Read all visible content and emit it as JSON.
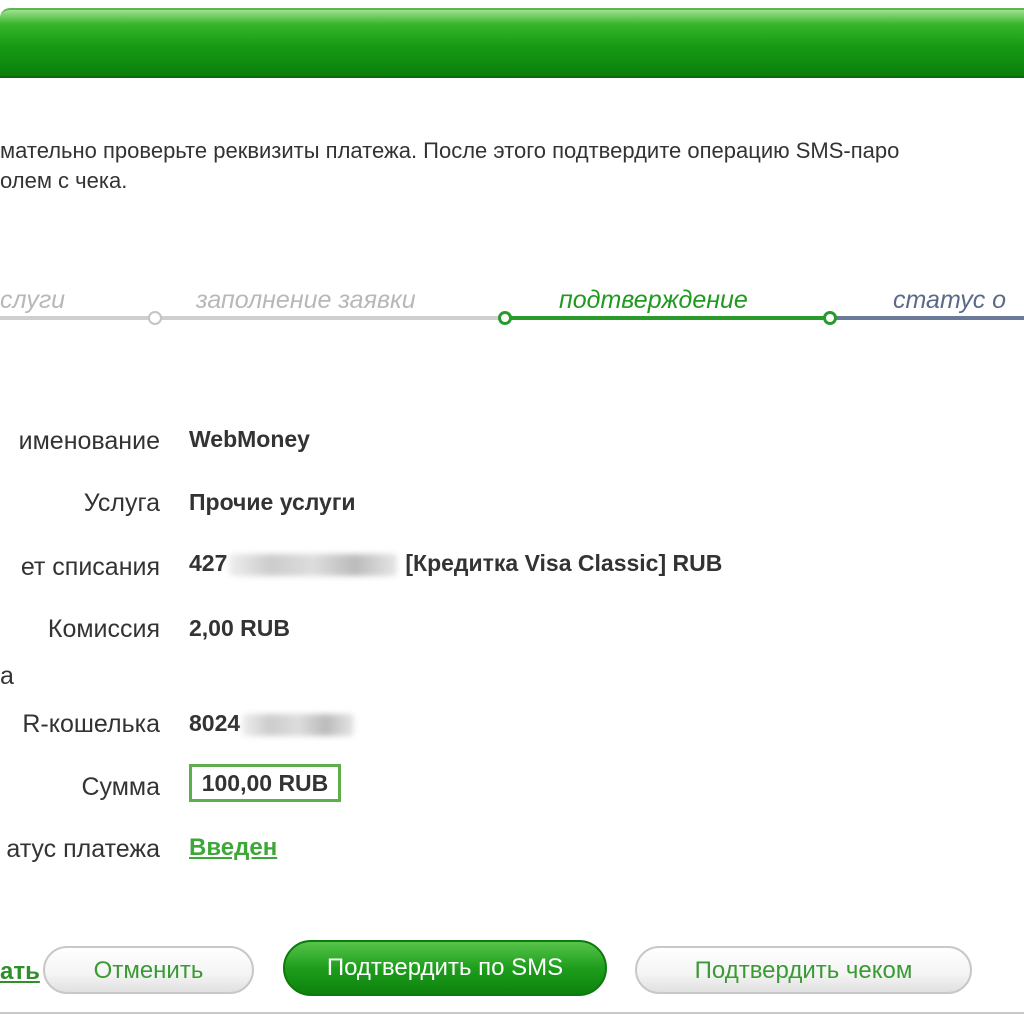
{
  "header": {
    "title": ""
  },
  "intro": {
    "line1": "мательно проверьте реквизиты платежа. После этого подтвердите операцию SMS-паро",
    "line2": "олем с чека."
  },
  "steps": [
    {
      "label": "слуги",
      "state": "done"
    },
    {
      "label": "заполнение заявки",
      "state": "done"
    },
    {
      "label": "подтверждение",
      "state": "active"
    },
    {
      "label": "статус о",
      "state": "next"
    }
  ],
  "details": {
    "name_label": "именование",
    "name_value": "WebMoney",
    "service_label": "Услуга",
    "service_value": "Прочие услуги",
    "account_label": "ет списания",
    "account_prefix": "427",
    "account_suffix": "[Кредитка Visa Classic]  RUB",
    "commission_label": "Комиссия",
    "commission_value": "2,00 RUB",
    "section_label": "а",
    "wallet_label": "R-кошелька",
    "wallet_prefix": "8024",
    "amount_label": "Сумма",
    "amount_value": "100,00 RUB",
    "status_label": "атус платежа",
    "status_value": "Введен"
  },
  "actions": {
    "back_label": "ать",
    "cancel_label": "Отменить",
    "confirm_sms_label": "Подтвердить по SMS",
    "confirm_check_label": "Подтвердить чеком"
  },
  "colors": {
    "brand_green": "#189a15",
    "active_step": "#1f9a1f",
    "next_step": "#5a6a88",
    "done_step": "#c8c8c8"
  }
}
